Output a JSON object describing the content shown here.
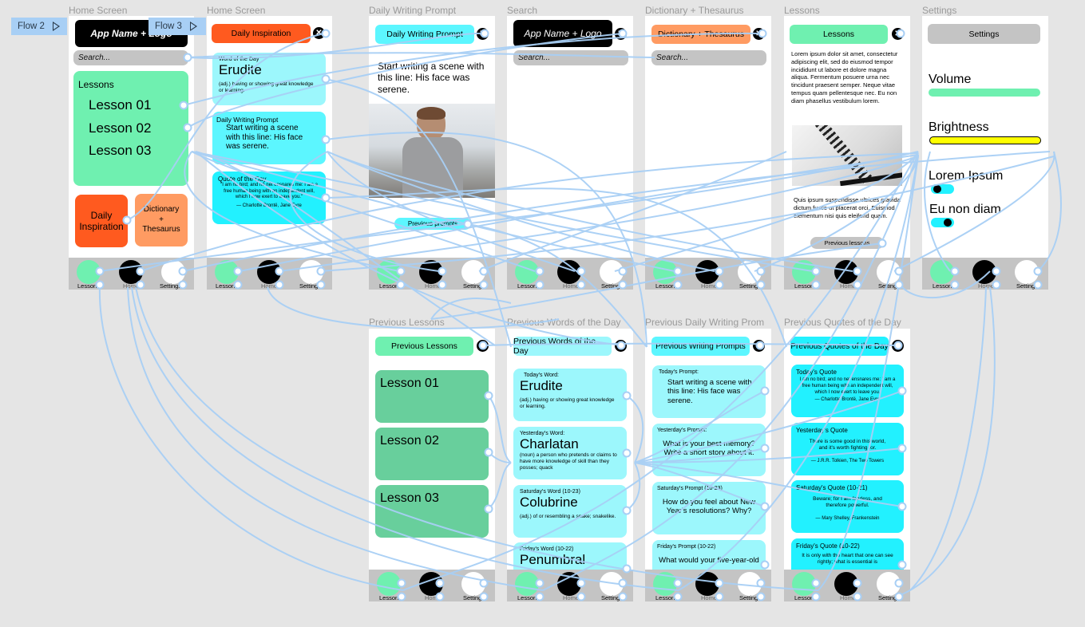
{
  "flows": [
    {
      "label": "Flow 2",
      "icon": "play-icon"
    },
    {
      "label": "Flow 3",
      "icon": "play-icon"
    }
  ],
  "colors": {
    "canvas": "#e5e5e5",
    "wire": "#a8cff5",
    "green": "#6ff0b0",
    "darkgreen": "#68cf9c",
    "orange_red": "#ff5a1f",
    "orange": "#ff9b62",
    "cyan": "#5cf6ff",
    "light_cyan": "#9cf7fc",
    "bright_cyan": "#22f1ff",
    "gray": "#c4c4c4",
    "yellow": "#ffff00"
  },
  "nav": {
    "lessons": "Lessons",
    "home": "Home",
    "settings": "Settings"
  },
  "common": {
    "app_name": "App Name + Logo",
    "search_placeholder": "Search...",
    "close": "✕"
  },
  "frames": {
    "home1": {
      "label": "Home Screen",
      "lessons_title": "Lessons",
      "lessons": [
        "Lesson 01",
        "Lesson 02",
        "Lesson 03"
      ],
      "daily_inspiration": "Daily Inspiration",
      "dictionary": [
        "Dictionary",
        "+",
        "Thesaurus"
      ]
    },
    "home2": {
      "label": "Home Screen",
      "header": "Daily Inspiration",
      "word_label": "Word of the Day",
      "word": "Erudite",
      "word_def": "(adj.) having or showing great knowledge or learning.",
      "prompt_label": "Daily Writing Prompt",
      "prompt": "Start writing a scene with this line: His face was serene.",
      "quote_label": "Quote of the Day",
      "quote": "\"I am no bird; and no net ensnares me: I am a free human being with an independent will, which I now exert to leave you.\"",
      "quote_author": "— Charlotte Brontë, Jane Eyre"
    },
    "prompt": {
      "label": "Daily Writing Prompt",
      "header": "Daily Writing Prompt",
      "text": "Start writing a scene with this line: His face was serene.",
      "image": "man-in-gray-shirt-photo",
      "button": "Previous prompts"
    },
    "search": {
      "label": "Search"
    },
    "dictionary": {
      "label": "Dictionary + Thesaurus",
      "header": "Dictionary + Thesaurus"
    },
    "lessons": {
      "label": "Lessons",
      "header": "Lessons",
      "body1": "Lorem ipsum dolor sit amet, consectetur adipiscing elit, sed do eiusmod tempor incididunt ut labore et dolore magna aliqua. Fermentum posuere urna nec tincidunt praesent semper. Neque vitae tempus quam pellentesque nec. Eu non diam phasellus vestibulum lorem.",
      "image": "notebook-photo",
      "body2": "Quis ipsum suspendisse ultrices gravida dictum fusce ut placerat orci. Euismod elementum nisi quis eleifend quam.",
      "button": "Previous lessons"
    },
    "settings": {
      "label": "Settings",
      "header": "Settings",
      "volume": "Volume",
      "volume_level": 1.0,
      "brightness": "Brightness",
      "brightness_level": 1.0,
      "toggle1": "Lorem Ipsum",
      "toggle1_on": false,
      "toggle2": "Eu non diam",
      "toggle2_on": true
    },
    "prev_lessons": {
      "label": "Previous Lessons",
      "header": "Previous Lessons",
      "lessons": [
        "Lesson 01",
        "Lesson 02",
        "Lesson 03"
      ]
    },
    "prev_words": {
      "label": "Previous Words of the Day",
      "header": "Previous Words of the Day",
      "items": [
        {
          "tag": "Today's Word:",
          "word": "Erudite",
          "def": "(adj.) having or showing great knowledge or learning."
        },
        {
          "tag": "Yesterday's Word:",
          "word": "Charlatan",
          "def": "(noun) a person who pretends or claims to have more knowledge of skill than they posses; quack"
        },
        {
          "tag": "Saturday's Word (10-23)",
          "word": "Colubrine",
          "def": "(adj.)  of or resembling a snake; snakelike."
        },
        {
          "tag": "Friday's Word (10-22)",
          "word": "Penumbral",
          "def": ""
        }
      ]
    },
    "prev_prompts": {
      "label": "Previous Daily Writing Prom",
      "header": "Previous Writing Prompts",
      "items": [
        {
          "tag": "Today's Prompt:",
          "text": "Start writing a scene with this line: His face was serene."
        },
        {
          "tag": "Yesterday's  Prompt:",
          "text": "What is your best memory? Write a short story about it."
        },
        {
          "tag": "Saturday's  Prompt (10-23)",
          "text": "How do you feel about New Year's resolutions? Why?"
        },
        {
          "tag": "Friday's  Prompt (10-22)",
          "text": "What would your five-year-old"
        }
      ]
    },
    "prev_quotes": {
      "label": "Previous Quotes of the Day",
      "header": "Previous Quotes of the Day",
      "items": [
        {
          "tag": "Today's Quote",
          "text": "I am no bird; and no net ensnares me: I am a free human being with an independent will, which I now exert to leave you.",
          "author": "— Charlotte Brontë, Jane Eyre"
        },
        {
          "tag": "Yesterday's Quote",
          "text": "There is some good in this world, and it's worth fighting for.",
          "author": "— J.R.R. Tolkien, The Two Towers"
        },
        {
          "tag": "Saturday's Quote (10-21)",
          "text": "Beware; for I am fearless, and therefore powerful.",
          "author": "— Mary Shelley, Frankenstein"
        },
        {
          "tag": "Friday's Quote (10-22)",
          "text": "It is only with the heart that one can see rightly; what is essential is",
          "author": ""
        }
      ]
    }
  }
}
